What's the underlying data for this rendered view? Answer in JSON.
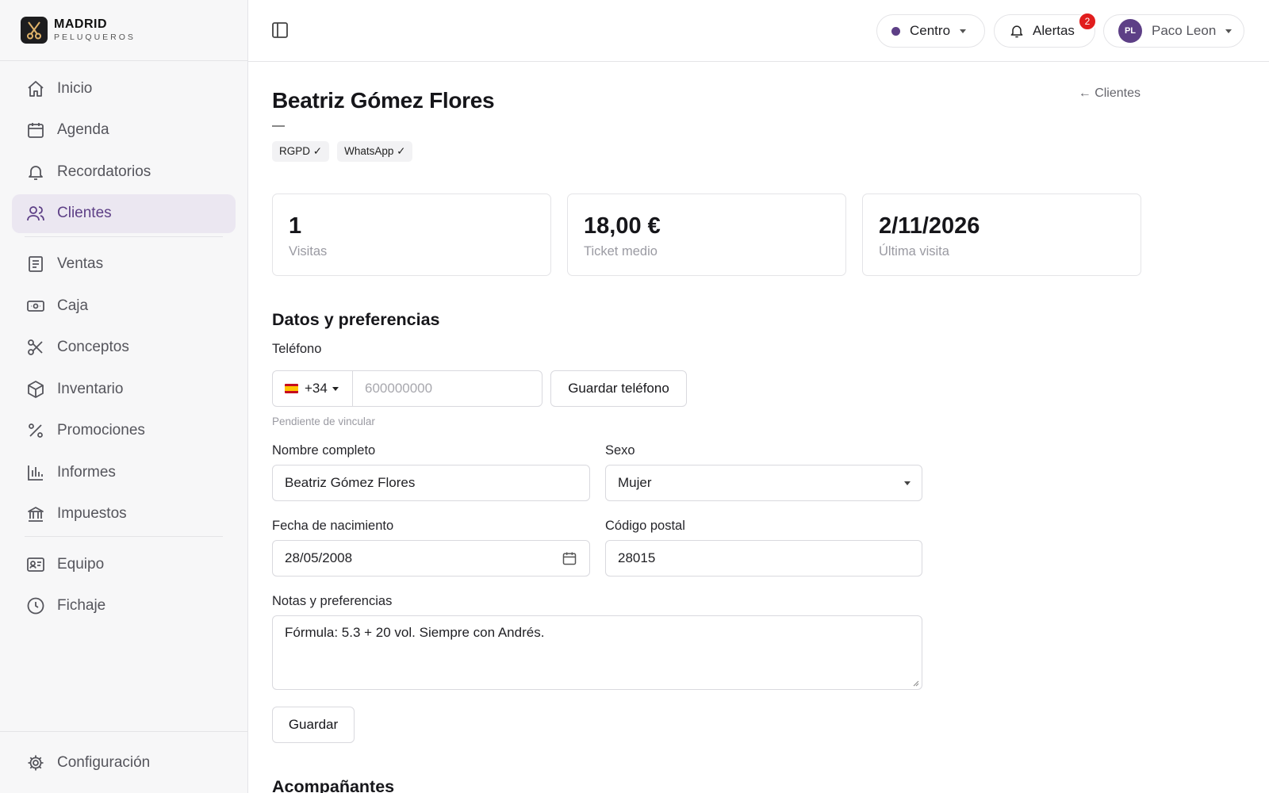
{
  "brand": {
    "name": "MADRID",
    "sub": "PELUQUEROS"
  },
  "sidebar": {
    "items": [
      {
        "label": "Inicio",
        "icon": "home-icon"
      },
      {
        "label": "Agenda",
        "icon": "calendar-icon"
      },
      {
        "label": "Recordatorios",
        "icon": "bell-icon"
      },
      {
        "label": "Clientes",
        "icon": "users-icon",
        "active": true
      },
      {
        "label": "Ventas",
        "icon": "receipt-icon"
      },
      {
        "label": "Caja",
        "icon": "cash-icon"
      },
      {
        "label": "Conceptos",
        "icon": "scissors-icon"
      },
      {
        "label": "Inventario",
        "icon": "box-icon"
      },
      {
        "label": "Promociones",
        "icon": "percent-icon"
      },
      {
        "label": "Informes",
        "icon": "bar-chart-icon"
      },
      {
        "label": "Impuestos",
        "icon": "bank-icon"
      },
      {
        "label": "Equipo",
        "icon": "id-card-icon"
      },
      {
        "label": "Fichaje",
        "icon": "clock-icon"
      }
    ],
    "settings_label": "Configuración"
  },
  "topbar": {
    "location": "Centro",
    "alerts_label": "Alertas",
    "alerts_count": "2",
    "user_initials": "PL",
    "user_name": "Paco Leon"
  },
  "client": {
    "name": "Beatriz Gómez Flores",
    "subtitle": "—",
    "back_label": "← Clientes",
    "tags": [
      "RGPD ✓",
      "WhatsApp ✓"
    ]
  },
  "stats": [
    {
      "value": "1",
      "label": "Visitas"
    },
    {
      "value": "18,00 €",
      "label": "Ticket medio"
    },
    {
      "value": "2/11/2026",
      "label": "Última visita"
    }
  ],
  "form": {
    "section_title": "Datos y preferencias",
    "phone_label": "Teléfono",
    "phone_code": "+34",
    "phone_placeholder": "600000000",
    "phone_save": "Guardar teléfono",
    "phone_hint": "Pendiente de vincular",
    "name_label": "Nombre completo",
    "name_value": "Beatriz Gómez Flores",
    "sex_label": "Sexo",
    "sex_value": "Mujer",
    "birth_label": "Fecha de nacimiento",
    "birth_value": "28/05/2008",
    "postal_label": "Código postal",
    "postal_value": "28015",
    "notes_label": "Notas y preferencias",
    "notes_value": "Fórmula: 5.3 + 20 vol. Siempre con Andrés.",
    "save_label": "Guardar"
  },
  "next_section_title": "Acompañantes",
  "colors": {
    "accent": "#5d3f86",
    "active_bg": "#ebe7f1",
    "badge": "#e11d1d"
  }
}
